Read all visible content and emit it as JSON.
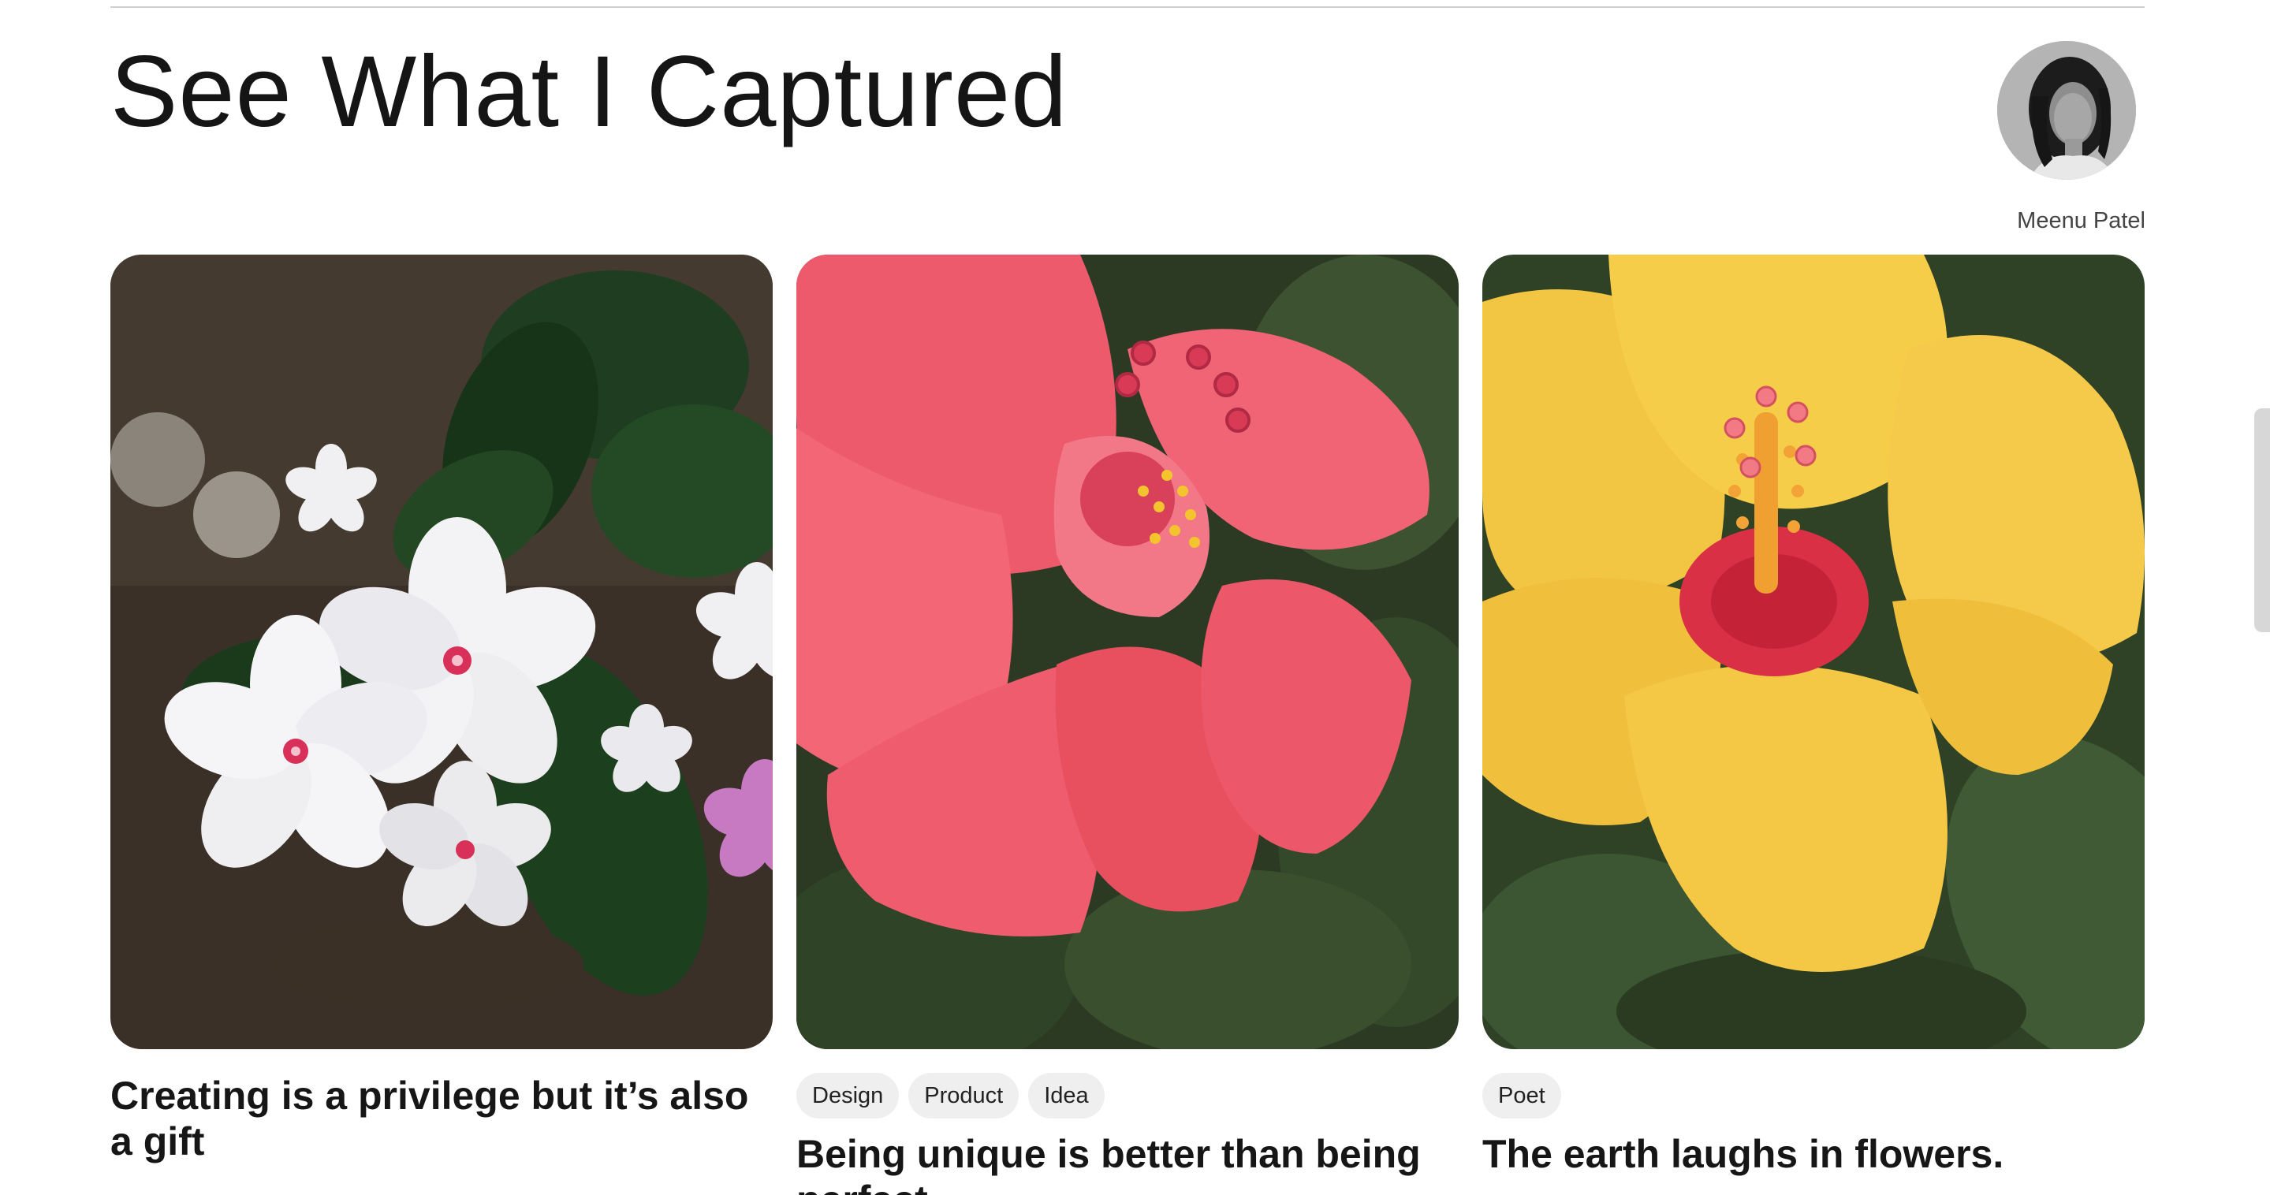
{
  "section": {
    "title": "See What I Captured"
  },
  "author": {
    "name": "Meenu Patel"
  },
  "cards": [
    {
      "image_subject": "white periwinkle flowers",
      "tags": [],
      "title": "Creating is a privilege but it’s also a gift"
    },
    {
      "image_subject": "pink hibiscus flower",
      "tags": [
        "Design",
        "Product",
        "Idea"
      ],
      "title": "Being unique is better than being perfect"
    },
    {
      "image_subject": "yellow hibiscus flower",
      "tags": [
        "Poet"
      ],
      "title": "The earth laughs in flowers."
    }
  ],
  "colors": {
    "background": "#ffffff",
    "text": "#151515",
    "tag_background": "#efefef",
    "rule": "#cfcfcf"
  }
}
